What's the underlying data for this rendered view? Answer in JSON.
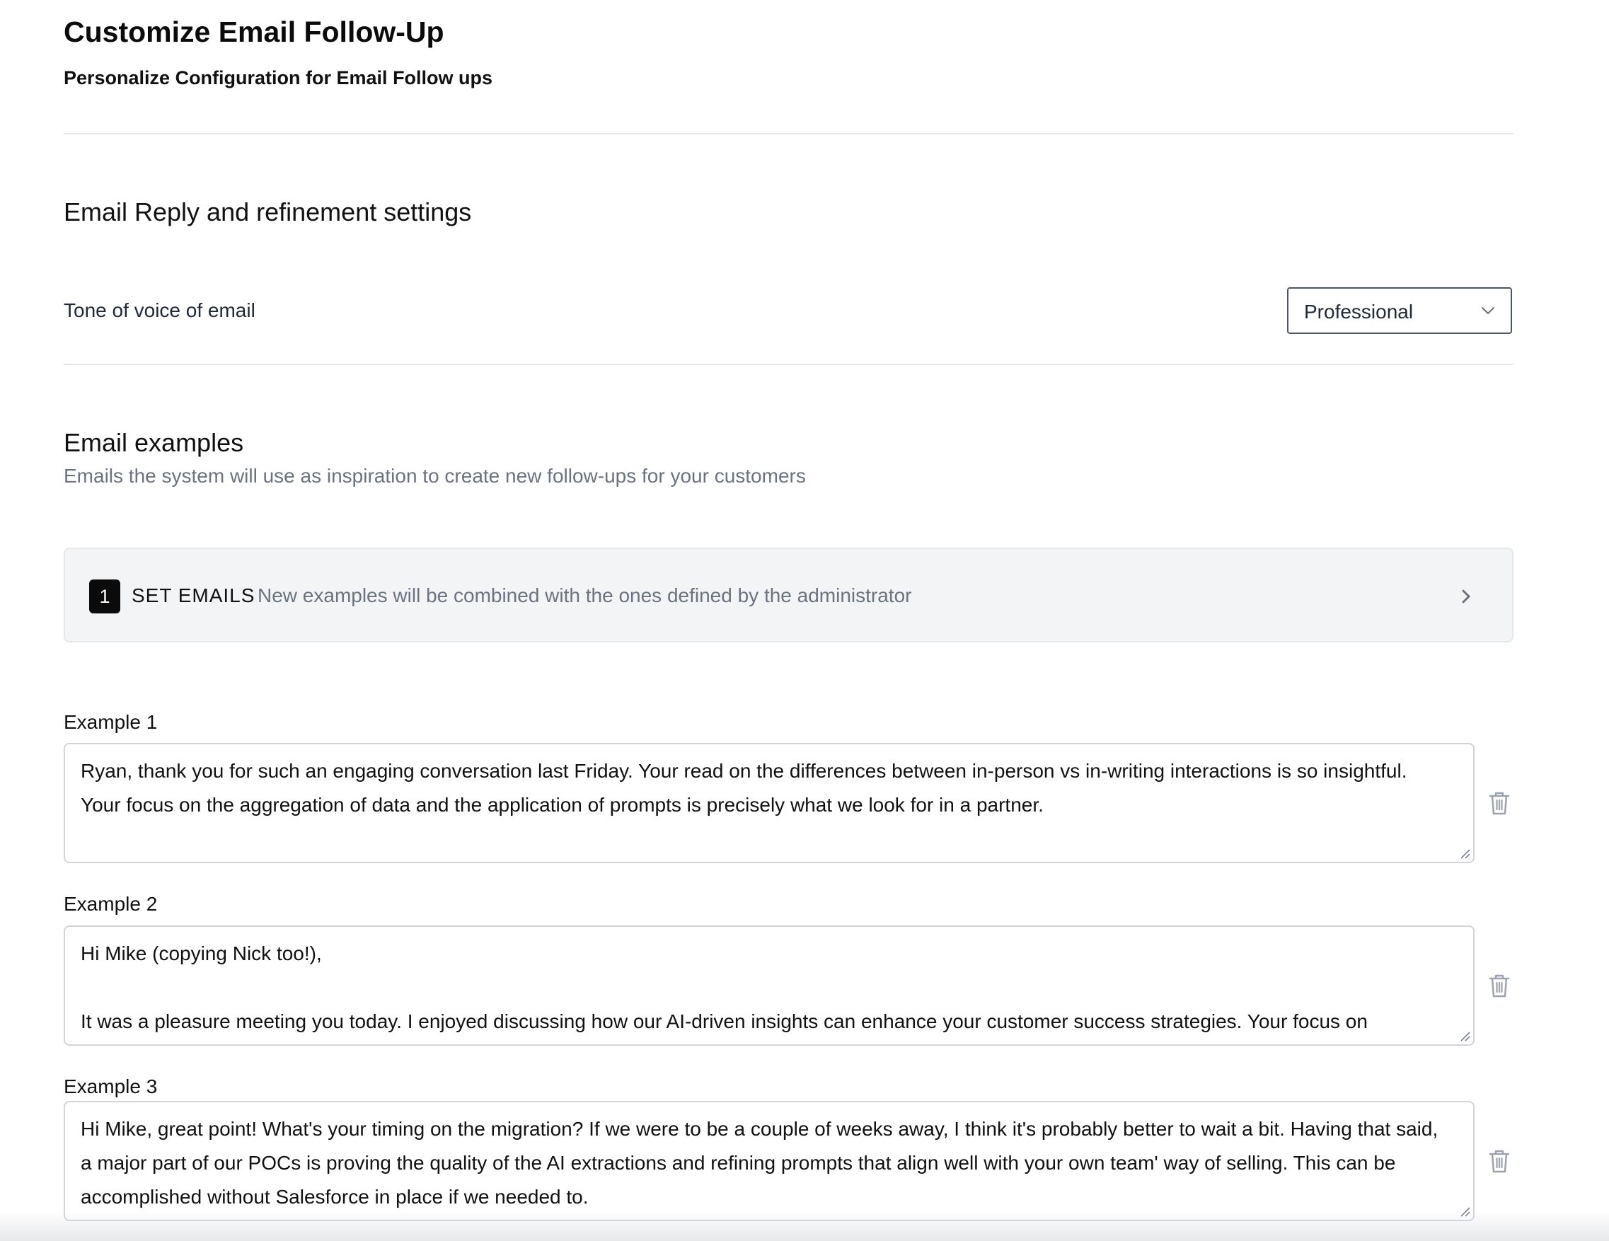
{
  "header": {
    "title": "Customize Email Follow-Up",
    "subtitle": "Personalize Configuration for Email Follow ups"
  },
  "reply_settings": {
    "title": "Email Reply and refinement settings",
    "tone_label": "Tone of voice of email",
    "tone_value": "Professional",
    "tone_icon": "chevron-down-icon"
  },
  "examples_section": {
    "title": "Email examples",
    "description": "Emails the system will use as inspiration to create new follow-ups for your customers",
    "set_emails": {
      "count": "1",
      "title": "SET EMAILS",
      "description": "New examples will be combined with the ones defined by the administrator",
      "icon": "chevron-right-icon"
    },
    "examples": [
      {
        "label": "Example 1",
        "text": "Ryan, thank you for such an engaging conversation last Friday. Your read on the differences between in-person vs in-writing interactions is so insightful. Your focus on the aggregation of data and the application of prompts is precisely what we look for in a partner.",
        "delete_icon": "trash-icon"
      },
      {
        "label": "Example 2",
        "text": "Hi Mike (copying Nick too!),\n\nIt was a pleasure meeting you today. I enjoyed discussing how our AI-driven insights can enhance your customer success strategies. Your focus on",
        "delete_icon": "trash-icon"
      },
      {
        "label": "Example 3",
        "text": "Hi Mike, great point! What's your timing on the migration? If we were to be a couple of weeks away, I think it's probably better to wait a bit. Having that said, a major part of our POCs is proving the quality of the AI extractions and refining prompts that align well with your own team' way of selling. This can be accomplished without Salesforce in place if we needed to.",
        "delete_icon": "trash-icon"
      }
    ]
  }
}
